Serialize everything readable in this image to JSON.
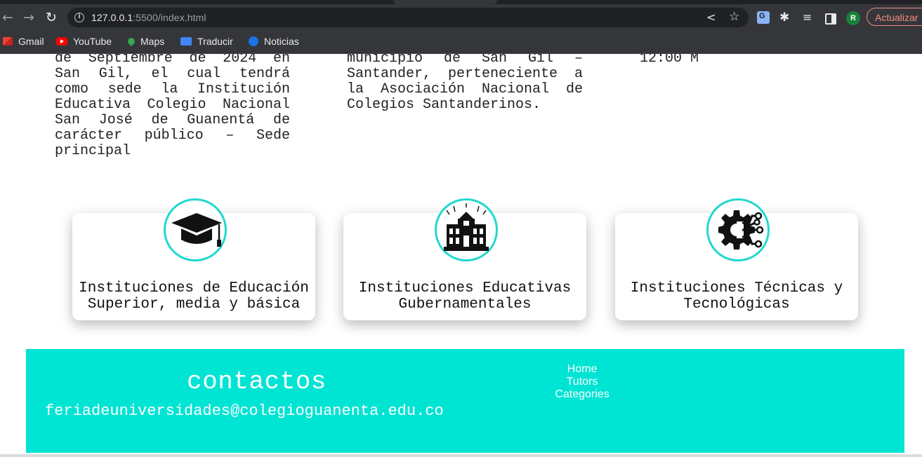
{
  "browser": {
    "url_host": "127.0.0.1",
    "url_rest": ":5500/index.html",
    "update_label": "Actualizar",
    "avatar_letter": "R",
    "bookmarks": [
      {
        "label": "Gmail"
      },
      {
        "label": "YouTube"
      },
      {
        "label": "Maps"
      },
      {
        "label": "Traducir"
      },
      {
        "label": "Noticias"
      }
    ]
  },
  "info": {
    "col1": "de Septiembre de 2024 en San Gil, el cual tendrá como sede la Institución Educativa Colegio Nacional San José de Guanentá de carácter público – Sede principal",
    "col2": "municipio de San Gil – Santander, perteneciente a la Asociación Nacional de Colegios Santanderinos.",
    "col3": "12:00 M"
  },
  "cards": [
    {
      "title": "Instituciones de Educación Superior, media y básica",
      "icon": "graduation-cap-icon"
    },
    {
      "title": "Instituciones Educativas Gubernamentales",
      "icon": "government-building-icon"
    },
    {
      "title": "Instituciones Técnicas y Tecnológicas",
      "icon": "tech-gear-circuit-icon"
    }
  ],
  "footer": {
    "heading": "contactos",
    "email": "feriadeuniversidades@colegioguanenta.edu.co",
    "links": [
      "Home",
      "Tutors",
      "Categories"
    ]
  },
  "colors": {
    "accent": "#00e4d4",
    "badge_border": "#22d8cf"
  }
}
